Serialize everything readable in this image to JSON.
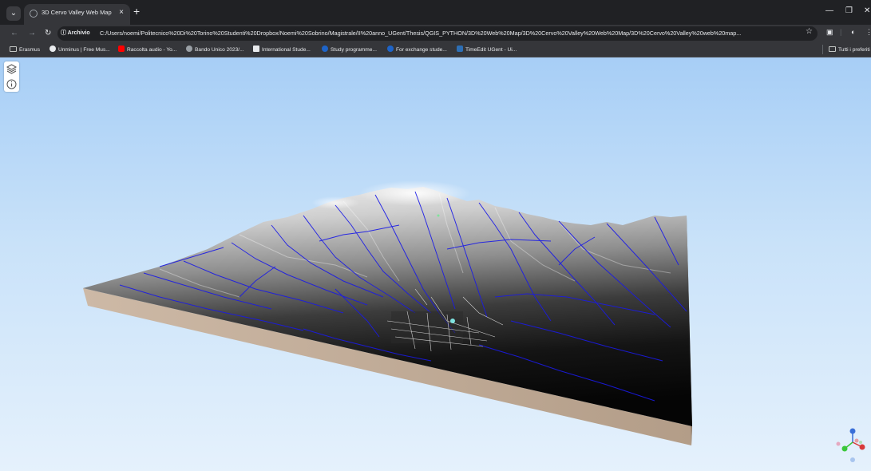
{
  "browser": {
    "tab_title": "3D Cervo Valley Web Map",
    "tab_close": "×",
    "new_tab": "+",
    "address_chip": "ⓘ Archivio",
    "url": "C:/Users/noemi/Politecnico%20Di%20Torino%20Studenti%20Dropbox/Noemi%20Sobrino/Magistrale/II%20anno_UGent/Thesis/QGIS_PYTHON/3D%20Web%20Map/3D%20Cervo%20Valley%20Web%20Map/3D%20Cervo%20Valley%20web%20map...",
    "bookmarks": [
      {
        "label": "Erasmus",
        "icon": "folder-icon",
        "color": "#c4c7c5"
      },
      {
        "label": "Unminus | Free Mus...",
        "icon": "unminus-icon",
        "color": "#e8eaed"
      },
      {
        "label": "Raccolta audio - Yo...",
        "icon": "youtube-icon",
        "color": "#ff0000"
      },
      {
        "label": "Bando Unico 2023/...",
        "icon": "globe-icon",
        "color": "#9aa0a6"
      },
      {
        "label": "International Stude...",
        "icon": "doc-icon",
        "color": "#e8eaed"
      },
      {
        "label": "Study programme...",
        "icon": "ugent-icon",
        "color": "#1e64c8"
      },
      {
        "label": "For exchange stude...",
        "icon": "ugent-icon",
        "color": "#1e64c8"
      },
      {
        "label": "TimeEdit UGent - Ui...",
        "icon": "timeedit-icon",
        "color": "#2d6fb5"
      }
    ],
    "all_bookmarks": "Tutti i preferiti"
  },
  "map": {
    "layers_icon": "layers-icon",
    "info_icon": "info-icon",
    "terrain_side_color": "#c4b09d",
    "stream_color": "#1a1ae6",
    "axes_icon": "axes-helper-icon"
  }
}
